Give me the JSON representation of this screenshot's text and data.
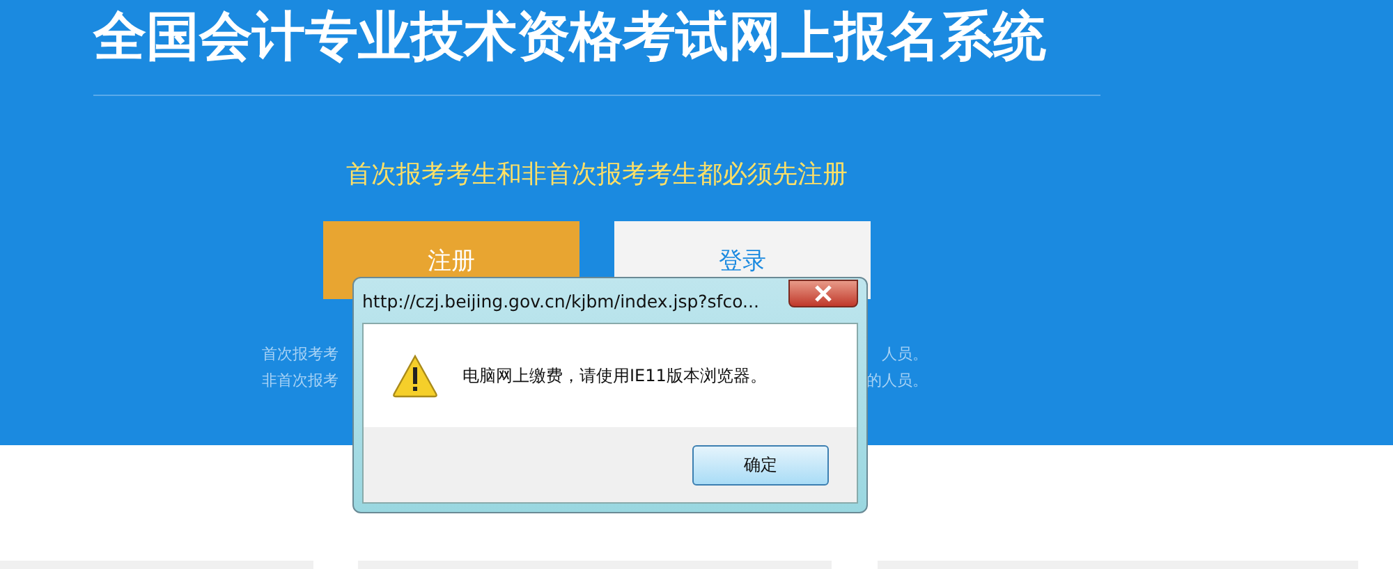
{
  "page_title": "全国会计专业技术资格考试网上报名系统",
  "notice": "首次报考考生和非首次报考考生都必须先注册",
  "buttons": [
    {
      "label": "注册",
      "kind": "primary"
    },
    {
      "label": "登录",
      "kind": "secondary"
    }
  ],
  "hint_lines": [
    {
      "left": "首次报考考",
      "right": "人员。"
    },
    {
      "left": "非首次报考",
      "right": "的人员。"
    }
  ],
  "dialog": {
    "title": "http://czj.beijing.gov.cn/kjbm/index.jsp?sfco...",
    "message": "电脑网上缴费，请使用IE11版本浏览器。",
    "ok_label": "确定"
  }
}
